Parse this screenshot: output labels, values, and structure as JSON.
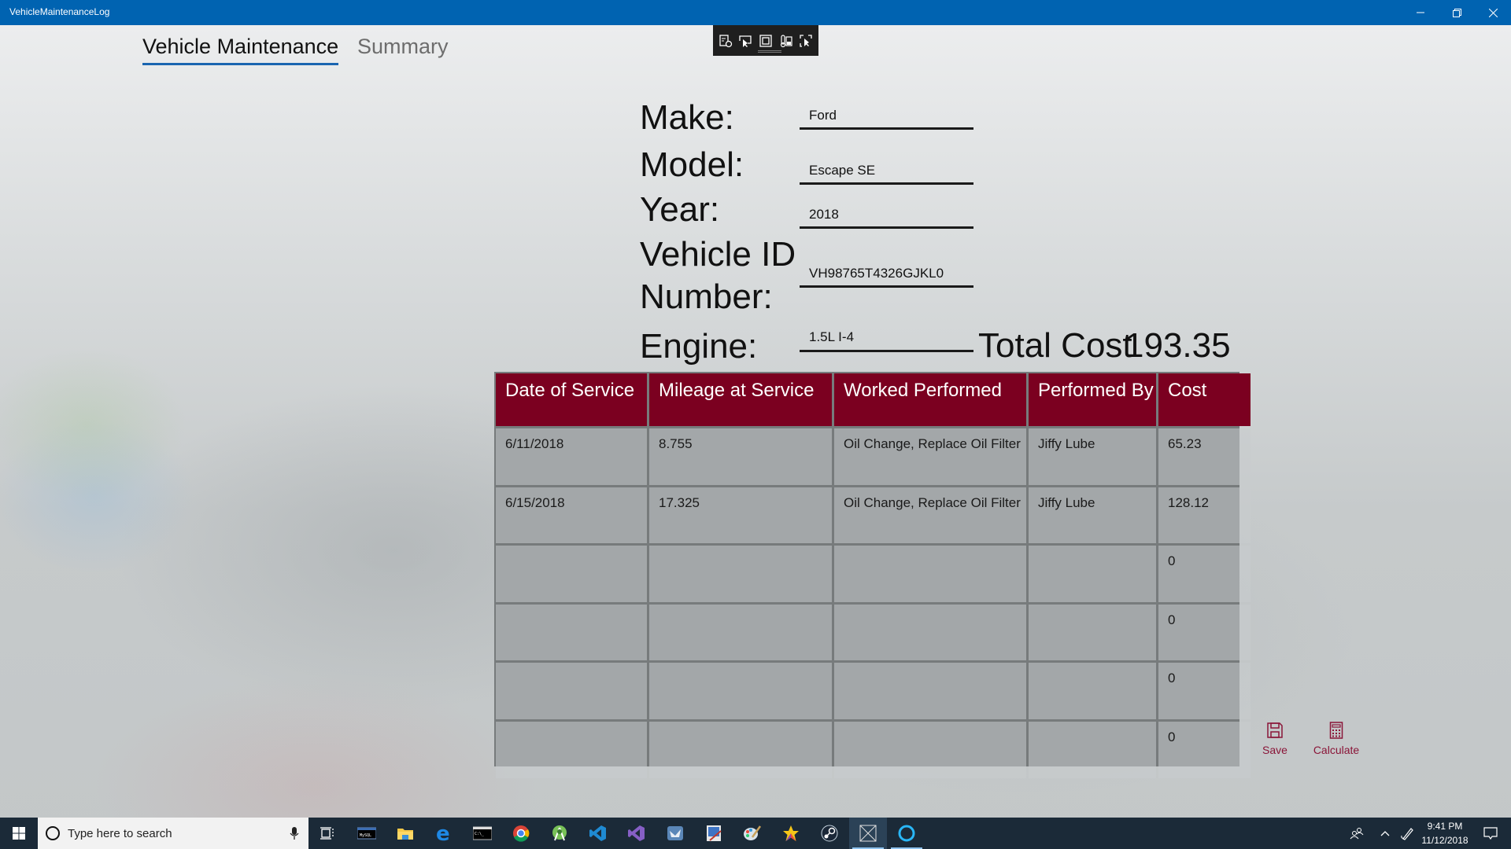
{
  "window": {
    "title": "VehicleMaintenanceLog",
    "controls": {
      "minimize": "—",
      "maximize": "❐",
      "close": "✕"
    }
  },
  "debug_toolbar": {
    "icons": [
      "select-element-icon",
      "display-layout-adorners-icon",
      "track-focus-icon",
      "xaml-binding-icon",
      "select-pointer-icon"
    ]
  },
  "tabs": [
    {
      "label": "Vehicle Maintenance",
      "active": true
    },
    {
      "label": "Summary",
      "active": false
    }
  ],
  "form": {
    "make": {
      "label": "Make:",
      "value": "Ford"
    },
    "model": {
      "label": "Model:",
      "value": "Escape SE"
    },
    "year": {
      "label": "Year:",
      "value": "2018"
    },
    "vin": {
      "label_line1": "Vehicle ID",
      "label_line2": "Number:",
      "value": "VH98765T4326GJKL0"
    },
    "engine": {
      "label": "Engine:",
      "value": "1.5L I-4"
    }
  },
  "total": {
    "label": "Total Cost",
    "value": "193.35"
  },
  "table": {
    "headers": [
      "Date of Service",
      "Mileage at Service",
      "Worked Performed",
      "Performed By",
      "Cost"
    ],
    "rows": [
      [
        "6/11/2018",
        "8.755",
        "Oil Change, Replace Oil Filter",
        "Jiffy Lube",
        "65.23"
      ],
      [
        "6/15/2018",
        "17.325",
        "Oil Change, Replace Oil Filter",
        "Jiffy Lube",
        "128.12"
      ],
      [
        "",
        "",
        "",
        "",
        "0"
      ],
      [
        "",
        "",
        "",
        "",
        "0"
      ],
      [
        "",
        "",
        "",
        "",
        "0"
      ],
      [
        "",
        "",
        "",
        "",
        "0"
      ]
    ]
  },
  "commands": {
    "save": "Save",
    "calculate": "Calculate"
  },
  "colors": {
    "titlebar": "#0063b1",
    "header": "#7b0020",
    "accent": "#8a1538",
    "tab_underline": "#1a65b0"
  },
  "taskbar": {
    "search_placeholder": "Type here to search",
    "apps": [
      "task-view",
      "mysql-console",
      "file-explorer",
      "edge",
      "command-prompt",
      "chrome",
      "android-studio",
      "vscode",
      "visual-studio",
      "app-store-bag",
      "paint-canvas",
      "paint",
      "star-app",
      "steam",
      "vehicle-maintenance-app",
      "cortana"
    ],
    "time": "9:41 PM",
    "date": "11/12/2018"
  }
}
